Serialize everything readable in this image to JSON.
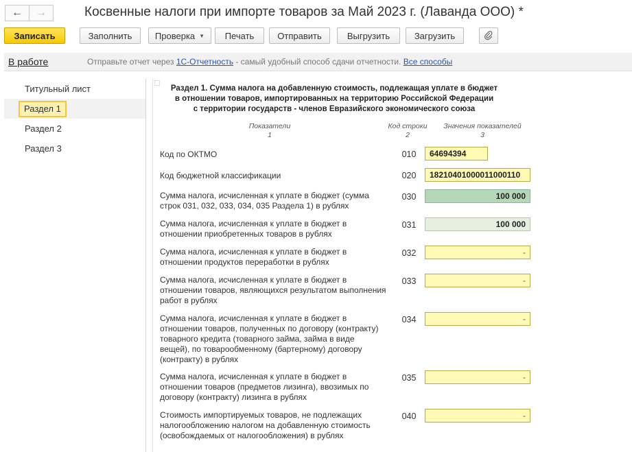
{
  "window": {
    "title": "Косвенные налоги при импорте товаров за Май 2023 г. (Лаванда ООО) *"
  },
  "nav": {
    "back_icon": "←",
    "forward_icon": "→"
  },
  "toolbar": {
    "save": "Записать",
    "fill": "Заполнить",
    "check": "Проверка",
    "print": "Печать",
    "send": "Отправить",
    "export": "Выгрузить",
    "import": "Загрузить",
    "attach_icon": "paperclip-icon"
  },
  "infobar": {
    "status": "В работе",
    "text_before": "Отправьте отчет через ",
    "link1": "1С-Отчетность",
    "text_after": " - самый удобный способ сдачи отчетности. ",
    "link2": "Все способы"
  },
  "sidebar": {
    "items": [
      {
        "label": "Титульный лист"
      },
      {
        "label": "Раздел 1"
      },
      {
        "label": "Раздел 2"
      },
      {
        "label": "Раздел 3"
      }
    ]
  },
  "section": {
    "title_line1": "Раздел 1. Сумма налога на добавленную стоимость, подлежащая уплате в бюджет",
    "title_line2": "в отношении товаров, импортированных на территорию Российской Федерации",
    "title_line3": "с территории государств - членов Евразийского экономического союза",
    "col_indicators": "Показатели",
    "col_indicators_num": "1",
    "col_code": "Код строки",
    "col_code_num": "2",
    "col_values": "Значения показателей",
    "col_values_num": "3"
  },
  "rows": [
    {
      "label": "Код по ОКТМО",
      "code": "010",
      "value": "64694394"
    },
    {
      "label": "Код бюджетной классификации",
      "code": "020",
      "value": "18210401000011000110"
    },
    {
      "label": "Сумма налога, исчисленная к уплате в бюджет (сумма строк 031, 032, 033, 034, 035 Раздела 1) в рублях",
      "code": "030",
      "value": "100 000"
    },
    {
      "label": "Сумма налога, исчисленная к уплате в бюджет в отношении приобретенных товаров в рублях",
      "code": "031",
      "value": "100 000"
    },
    {
      "label": "Сумма налога, исчисленная к уплате в бюджет в отношении продуктов переработки в рублях",
      "code": "032",
      "value": "-"
    },
    {
      "label": "Сумма налога, исчисленная к уплате в бюджет в отношении товаров, являющихся результатом выполнения работ в рублях",
      "code": "033",
      "value": "-"
    },
    {
      "label": "Сумма налога, исчисленная к уплате в бюджет в отношении товаров, полученных по договору (контракту) товарного кредита (товарного займа, займа в виде вещей), по товарообменному (бартерному) договору (контракту) в рублях",
      "code": "034",
      "value": "-"
    },
    {
      "label": "Сумма налога, исчисленная к уплате в бюджет в отношении товаров (предметов лизинга), ввозимых по договору (контракту) лизинга в рублях",
      "code": "035",
      "value": "-"
    },
    {
      "label": "Стоимость импортируемых товаров, не подлежащих налогообложению налогом на добавленную стоимость (освобождаемых от налогообложения) в рублях",
      "code": "040",
      "value": "-"
    }
  ]
}
